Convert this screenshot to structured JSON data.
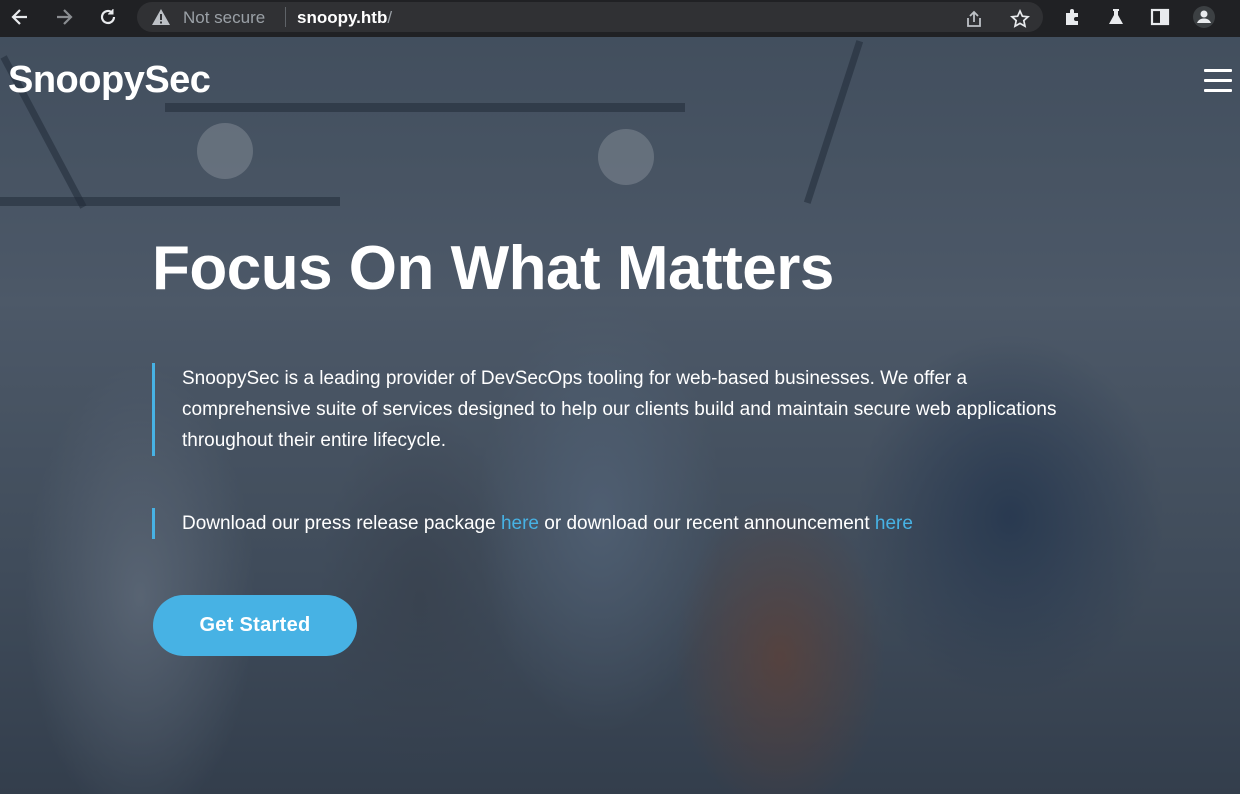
{
  "browser": {
    "security_label": "Not secure",
    "url_host": "snoopy.htb",
    "url_path": "/"
  },
  "site": {
    "brand": "SnoopySec",
    "hero_title": "Focus On What Matters",
    "intro": "SnoopySec is a leading provider of DevSecOps tooling for web-based businesses. We offer a comprehensive suite of services designed to help our clients build and maintain secure web applications throughout their entire lifecycle.",
    "download_text_1": "Download our press release package ",
    "download_link_1": "here",
    "download_text_2": " or download our recent announcement ",
    "download_link_2": "here",
    "cta_label": "Get Started"
  },
  "colors": {
    "accent": "#47b2e4",
    "chrome_bg": "#202124"
  },
  "icons": [
    "back-icon",
    "forward-icon",
    "reload-icon",
    "warning-icon",
    "share-icon",
    "star-icon",
    "puzzle-icon",
    "flask-icon",
    "sidebar-icon",
    "profile-icon",
    "hamburger-menu-icon"
  ]
}
